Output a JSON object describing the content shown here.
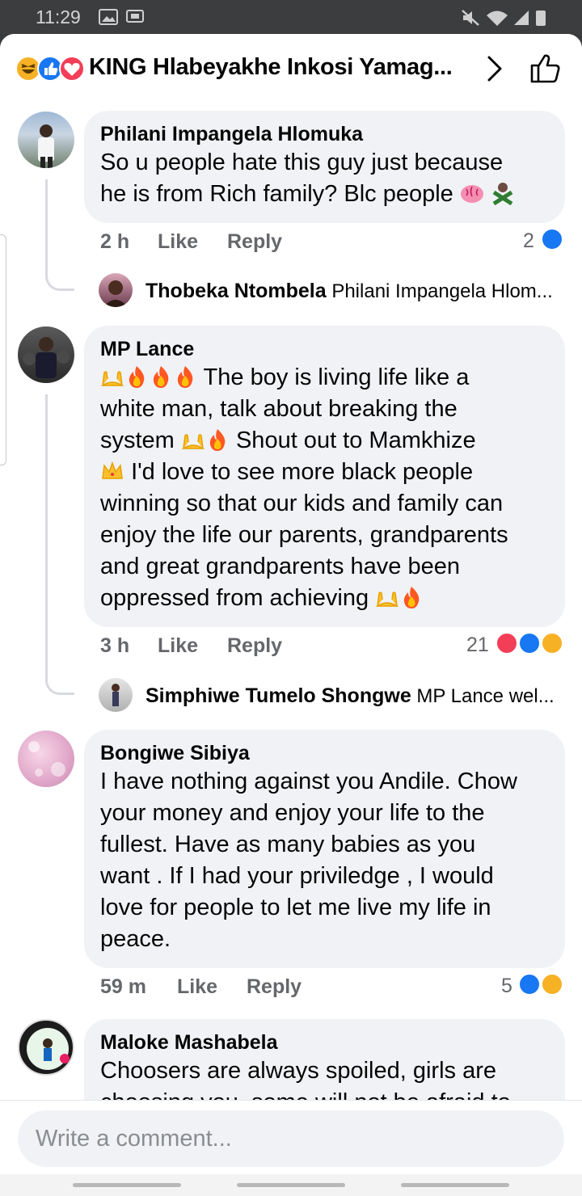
{
  "status_bar": {
    "time": "11:29"
  },
  "header": {
    "title": "KING Hlabeyakhe Inkosi Yamag..."
  },
  "comments": [
    {
      "author": "Philani Impangela Hlomuka",
      "line1": "So u people hate this guy just because",
      "line2": "he is from Rich family? Blc people",
      "time": "2 h",
      "like": "Like",
      "reply": "Reply",
      "reactions": "2",
      "reply_preview": {
        "author": "Thobeka Ntombela",
        "text": "Philani Impangela Hlom..."
      }
    },
    {
      "author": "MP Lance",
      "line1": "The boy is living life like a",
      "line2": "white man, talk about breaking the",
      "line3": "system",
      "line3b": "Shout out to Mamkhize",
      "line4": "I'd love to see more black people",
      "line5": "winning so that our kids and family can",
      "line6": "enjoy the life our parents, grandparents",
      "line7": "and great grandparents have been",
      "line8": "oppressed from achieving",
      "time": "3 h",
      "like": "Like",
      "reply": "Reply",
      "reactions": "21",
      "reply_preview": {
        "author": "Simphiwe Tumelo Shongwe",
        "text": "MP Lance wel..."
      }
    },
    {
      "author": "Bongiwe Sibiya",
      "lines": [
        "I have nothing against you Andile. Chow",
        "your money and enjoy your life to the",
        "fullest. Have as many babies as you",
        "want . If I had your priviledge , I would",
        "love for people to let me live my life in",
        "peace."
      ],
      "time": "59 m",
      "like": "Like",
      "reply": "Reply",
      "reactions": "5"
    },
    {
      "author": "Maloke Mashabela",
      "line1": "Choosers are always spoiled, girls are",
      "line2": "choosing you, some will not be afraid to"
    }
  ],
  "composer": {
    "placeholder": "Write a comment..."
  },
  "colors": {
    "like_blue": "#1877f2",
    "love_red": "#f33e58",
    "haha_yellow": "#f7b125",
    "text_secondary": "#65676b",
    "bubble_bg": "#f0f2f5"
  }
}
